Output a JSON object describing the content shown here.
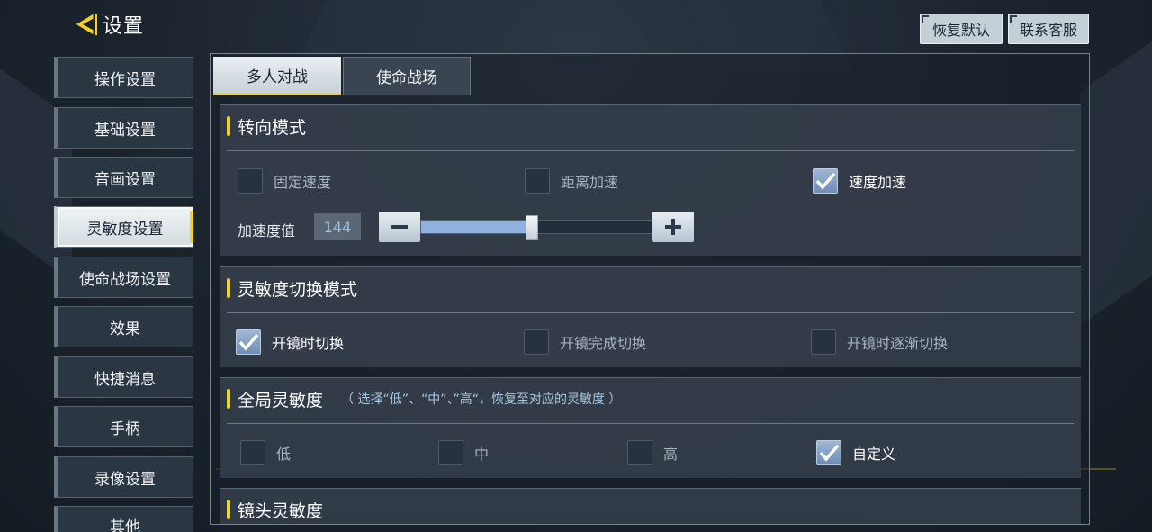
{
  "header": {
    "title": "设置",
    "restore_default": "恢复默认",
    "contact_service": "联系客服"
  },
  "sidebar": {
    "items": [
      {
        "label": "操作设置"
      },
      {
        "label": "基础设置"
      },
      {
        "label": "音画设置"
      },
      {
        "label": "灵敏度设置"
      },
      {
        "label": "使命战场设置"
      },
      {
        "label": "效果"
      },
      {
        "label": "快捷消息"
      },
      {
        "label": "手柄"
      },
      {
        "label": "录像设置"
      },
      {
        "label": "其他"
      }
    ],
    "active_index": 3
  },
  "tabs": [
    {
      "label": "多人对战"
    },
    {
      "label": "使命战场"
    }
  ],
  "active_tab": 0,
  "sections": {
    "turn_mode": {
      "title": "转向模式",
      "options": [
        {
          "label": "固定速度",
          "checked": false
        },
        {
          "label": "距离加速",
          "checked": false
        },
        {
          "label": "速度加速",
          "checked": true
        }
      ],
      "accel_label": "加速度值",
      "accel_value": "144",
      "accel_fraction": 0.48,
      "minus_icon": "minus-icon",
      "plus_icon": "plus-icon"
    },
    "switch_mode": {
      "title": "灵敏度切换模式",
      "options": [
        {
          "label": "开镜时切换",
          "checked": true
        },
        {
          "label": "开镜完成切换",
          "checked": false
        },
        {
          "label": "开镜时逐渐切换",
          "checked": false
        }
      ]
    },
    "global": {
      "title": "全局灵敏度",
      "hint": "（ 选择“低”、“中”、”高“，恢复至对应的灵敏度 ）",
      "options": [
        {
          "label": "低",
          "checked": false
        },
        {
          "label": "中",
          "checked": false
        },
        {
          "label": "高",
          "checked": false
        },
        {
          "label": "自定义",
          "checked": true
        }
      ]
    },
    "scope": {
      "title": "镜头灵敏度"
    }
  },
  "colors": {
    "accent": "#f5d321",
    "check": "#7c98bd"
  }
}
